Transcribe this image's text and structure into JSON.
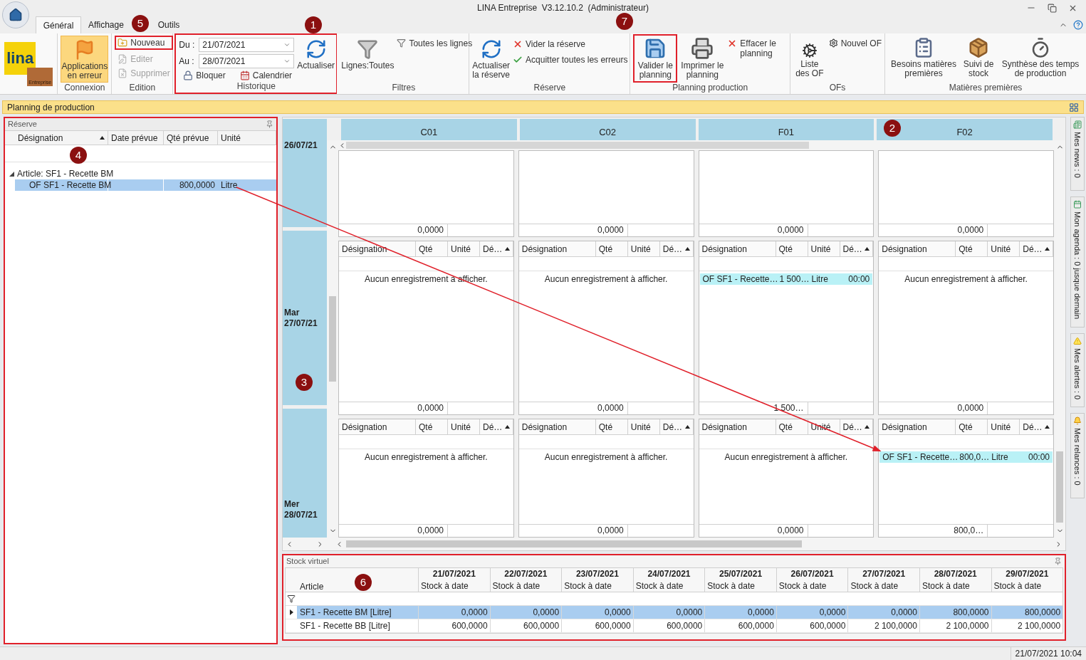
{
  "window": {
    "title": "LINA Entreprise  V3.12.10.2  (Administrateur)"
  },
  "tabs": [
    {
      "label": "Général",
      "selected": true
    },
    {
      "label": "Affichage",
      "selected": false
    },
    {
      "label": "Outils",
      "selected": false
    }
  ],
  "logo": {
    "name": "lina",
    "subtitle": "Entreprise"
  },
  "ribbon": {
    "connexion": {
      "label": "Connexion",
      "applications": {
        "label": "Applications en erreur",
        "highlighted": true
      }
    },
    "edition": {
      "label": "Edition",
      "buttons": [
        {
          "label": "Nouveau",
          "disabled": false
        },
        {
          "label": "Editer",
          "disabled": true
        },
        {
          "label": "Supprimer",
          "disabled": true
        }
      ]
    },
    "historique": {
      "label": "Historique",
      "du_label": "Du :",
      "du_value": "21/07/2021",
      "au_label": "Au :",
      "au_value": "28/07/2021",
      "bloquer": "Bloquer",
      "calendrier": "Calendrier",
      "actualiser": "Actualiser"
    },
    "filtres": {
      "label": "Filtres",
      "lignes": "Lignes:Toutes",
      "toutes": "Toutes les lignes"
    },
    "reserve": {
      "label": "Réserve",
      "actualiser": "Actualiser la réserve",
      "vider": "Vider la réserve",
      "acquitter": "Acquitter toutes les erreurs"
    },
    "planning": {
      "label": "Planning production",
      "valider": "Valider le planning",
      "imprimer": "Imprimer le planning",
      "effacer": "Effacer le planning"
    },
    "ofs": {
      "label": "OFs",
      "liste": "Liste des OF",
      "nouvel": "Nouvel OF"
    },
    "matieres": {
      "label": "Matières premières",
      "besoins": "Besoins matières premières",
      "suivi": "Suivi de stock",
      "synthese": "Synthèse des temps de production"
    }
  },
  "panel_title": "Planning de production",
  "reserve_panel": {
    "title": "Réserve",
    "columns": [
      {
        "label": "Désignation",
        "sorted": true
      },
      {
        "label": "Date prévue",
        "sorted": false
      },
      {
        "label": "Qté prévue",
        "sorted": false
      },
      {
        "label": "Unité",
        "sorted": false
      }
    ],
    "groups": [
      {
        "label": "Article: SF1 - Recette BM",
        "expanded": true,
        "rows": [
          {
            "designation": "OF SF1 - Recette BM",
            "qty": "800,0000",
            "unit": "Litre",
            "selected": true
          }
        ]
      }
    ]
  },
  "planning": {
    "columns": [
      "C01",
      "C02",
      "F01",
      "F02"
    ],
    "days": [
      {
        "date": "26/07/21",
        "cells": [
          {
            "total": "0,0000"
          },
          {
            "total": "0,0000"
          },
          {
            "total": "0,0000"
          },
          {
            "total": "0,0000"
          }
        ]
      },
      {
        "weekday": "Mar",
        "date": "27/07/21",
        "cells": [
          {
            "columns": [
              {
                "label": "Désignation",
                "sorted": false
              },
              {
                "label": "Qté",
                "sorted": false
              },
              {
                "label": "Unité",
                "sorted": false
              },
              {
                "label": "Dé…",
                "sorted": true
              }
            ],
            "empty_text": "Aucun enregistrement à afficher.",
            "total": "0,0000"
          },
          {
            "columns": [
              {
                "label": "Désignation",
                "sorted": false
              },
              {
                "label": "Qté",
                "sorted": false
              },
              {
                "label": "Unité",
                "sorted": false
              },
              {
                "label": "Dé…",
                "sorted": true
              }
            ],
            "empty_text": "Aucun enregistrement à afficher.",
            "total": "0,0000"
          },
          {
            "columns": [
              {
                "label": "Désignation",
                "sorted": false
              },
              {
                "label": "Qté",
                "sorted": false
              },
              {
                "label": "Unité",
                "sorted": false
              },
              {
                "label": "Dé…",
                "sorted": true
              }
            ],
            "records": [
              {
                "designation": "OF SF1 - Recette…",
                "qty": "1 500…",
                "unit": "Litre",
                "time": "00:00"
              }
            ],
            "total": "1 500…"
          },
          {
            "columns": [
              {
                "label": "Désignation",
                "sorted": false
              },
              {
                "label": "Qté",
                "sorted": false
              },
              {
                "label": "Unité",
                "sorted": false
              },
              {
                "label": "Dé…",
                "sorted": true
              }
            ],
            "empty_text": "Aucun enregistrement à afficher.",
            "total": "0,0000"
          }
        ]
      },
      {
        "weekday": "Mer",
        "date": "28/07/21",
        "cells": [
          {
            "columns": [
              {
                "label": "Désignation",
                "sorted": false
              },
              {
                "label": "Qté",
                "sorted": false
              },
              {
                "label": "Unité",
                "sorted": false
              },
              {
                "label": "Dé…",
                "sorted": true
              }
            ],
            "empty_text": "Aucun enregistrement à afficher.",
            "total": "0,0000"
          },
          {
            "columns": [
              {
                "label": "Désignation",
                "sorted": false
              },
              {
                "label": "Qté",
                "sorted": false
              },
              {
                "label": "Unité",
                "sorted": false
              },
              {
                "label": "Dé…",
                "sorted": true
              }
            ],
            "empty_text": "Aucun enregistrement à afficher.",
            "total": "0,0000"
          },
          {
            "columns": [
              {
                "label": "Désignation",
                "sorted": false
              },
              {
                "label": "Qté",
                "sorted": false
              },
              {
                "label": "Unité",
                "sorted": false
              },
              {
                "label": "Dé…",
                "sorted": true
              }
            ],
            "empty_text": "Aucun enregistrement à afficher.",
            "total": "0,0000"
          },
          {
            "columns": [
              {
                "label": "Désignation",
                "sorted": false
              },
              {
                "label": "Qté",
                "sorted": false
              },
              {
                "label": "Unité",
                "sorted": false
              },
              {
                "label": "Dé…",
                "sorted": true
              }
            ],
            "records": [
              {
                "designation": "OF SF1 - Recette…",
                "qty": "800,0…",
                "unit": "Litre",
                "time": "00:00"
              }
            ],
            "total": "800,0…"
          }
        ]
      }
    ]
  },
  "stock_panel": {
    "title": "Stock virtuel",
    "article_header": "Article",
    "columns": [
      {
        "date": "21/07/2021",
        "label": "Stock à date"
      },
      {
        "date": "22/07/2021",
        "label": "Stock à date"
      },
      {
        "date": "23/07/2021",
        "label": "Stock à date"
      },
      {
        "date": "24/07/2021",
        "label": "Stock à date"
      },
      {
        "date": "25/07/2021",
        "label": "Stock à date"
      },
      {
        "date": "26/07/2021",
        "label": "Stock à date"
      },
      {
        "date": "27/07/2021",
        "label": "Stock à date"
      },
      {
        "date": "28/07/2021",
        "label": "Stock à date"
      },
      {
        "date": "29/07/2021",
        "label": "Stock à date"
      }
    ],
    "rows": [
      {
        "article": "SF1 - Recette BM [Litre]",
        "selected": true,
        "values": [
          "0,0000",
          "0,0000",
          "0,0000",
          "0,0000",
          "0,0000",
          "0,0000",
          "0,0000",
          "800,0000",
          "800,0000"
        ]
      },
      {
        "article": "SF1 - Recette BB [Litre]",
        "selected": false,
        "values": [
          "600,0000",
          "600,0000",
          "600,0000",
          "600,0000",
          "600,0000",
          "600,0000",
          "2 100,0000",
          "2 100,0000",
          "2 100,0000"
        ]
      }
    ]
  },
  "side_tabs": [
    "Mes news : 0",
    "Mon agenda : 0 jusque demain",
    "Mes alertes : 0",
    "Mes relances : 0"
  ],
  "status_bar": {
    "datetime": "21/07/2021 10:04"
  },
  "annotations": [
    {
      "label": "1"
    },
    {
      "label": "2"
    },
    {
      "label": "3"
    },
    {
      "label": "4"
    },
    {
      "label": "5"
    },
    {
      "label": "6"
    },
    {
      "label": "7"
    }
  ]
}
